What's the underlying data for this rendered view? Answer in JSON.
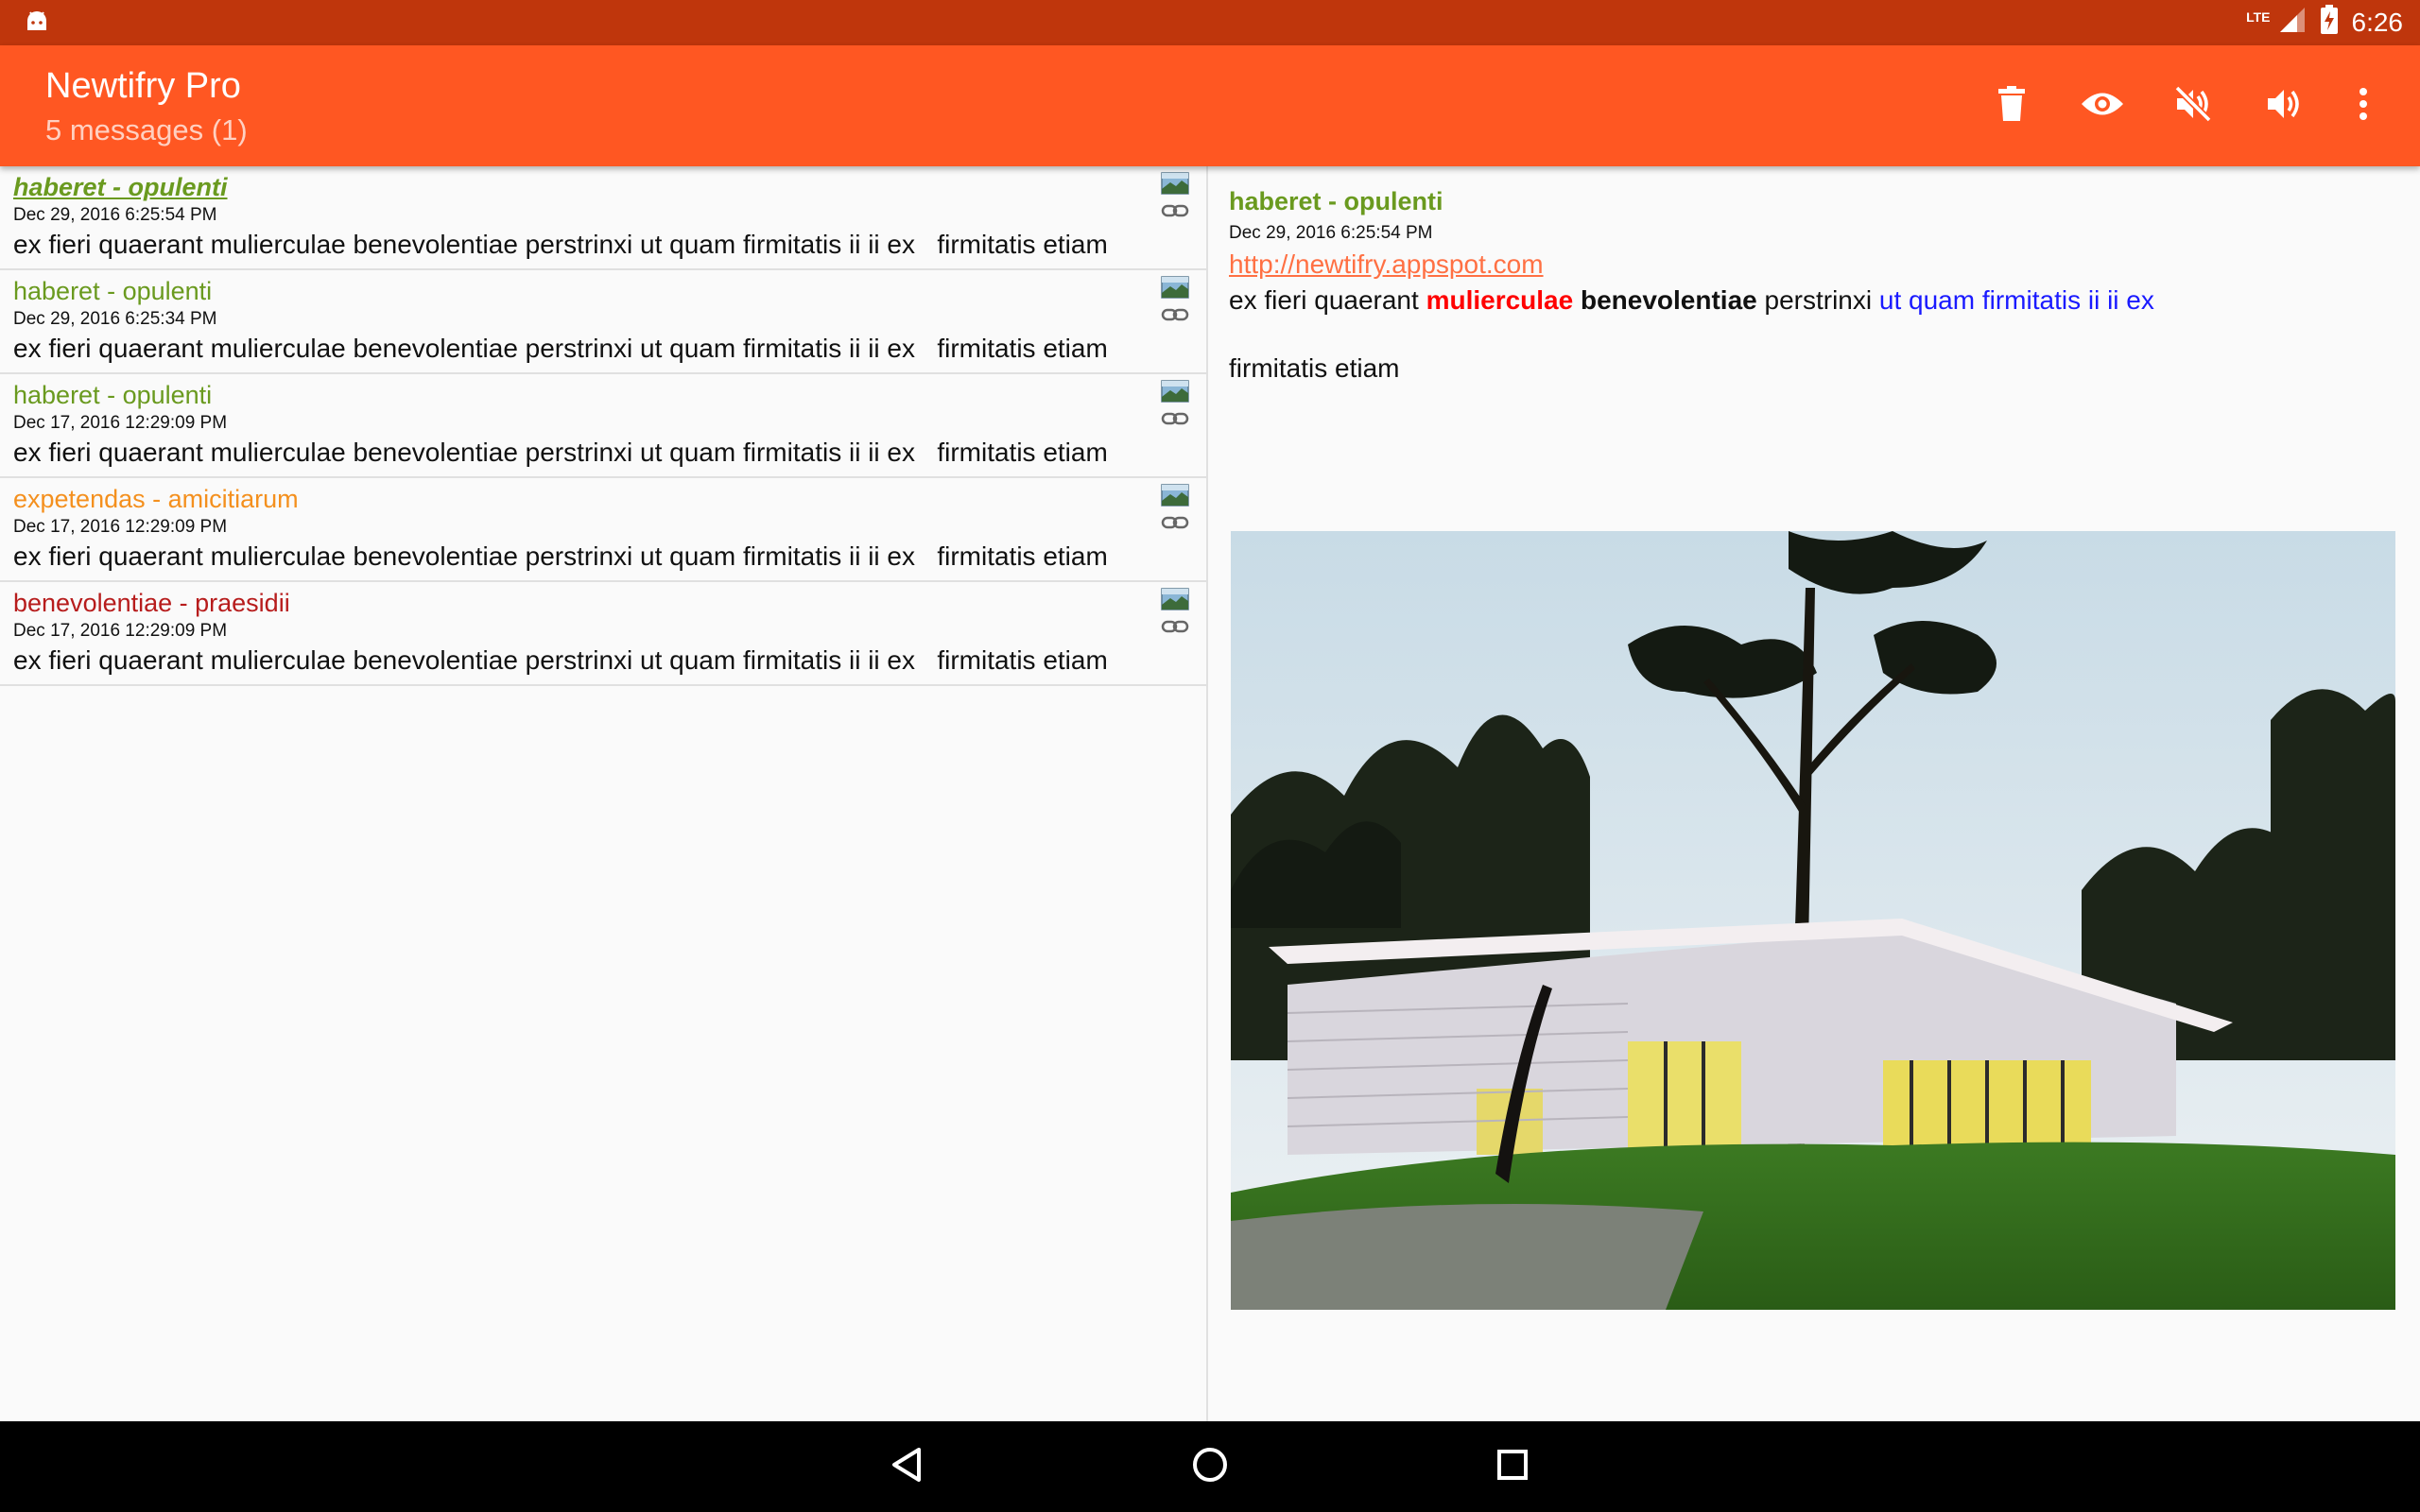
{
  "status_bar": {
    "network": "LTE",
    "time": "6:26"
  },
  "app_bar": {
    "title": "Newtifry Pro",
    "subtitle": "5 messages (1)",
    "actions": [
      "delete-icon",
      "eye-icon",
      "volume-off-icon",
      "volume-up-icon",
      "more-vert-icon"
    ]
  },
  "messages": [
    {
      "title": "haberet - opulenti",
      "date": "Dec 29, 2016 6:25:54 PM",
      "body": "ex fieri quaerant mulierculae benevolentiae perstrinxi ut quam firmitatis ii ii ex   firmitatis etiam",
      "color": "#6a9a1f",
      "selected": true
    },
    {
      "title": "haberet - opulenti",
      "date": "Dec 29, 2016 6:25:34 PM",
      "body": "ex fieri quaerant mulierculae benevolentiae perstrinxi ut quam firmitatis ii ii ex   firmitatis etiam",
      "color": "#6a9a1f",
      "selected": false
    },
    {
      "title": "haberet - opulenti",
      "date": "Dec 17, 2016 12:29:09 PM",
      "body": "ex fieri quaerant mulierculae benevolentiae perstrinxi ut quam firmitatis ii ii ex   firmitatis etiam",
      "color": "#6a9a1f",
      "selected": false
    },
    {
      "title": "expetendas - amicitiarum",
      "date": "Dec 17, 2016 12:29:09 PM",
      "body": "ex fieri quaerant mulierculae benevolentiae perstrinxi ut quam firmitatis ii ii ex   firmitatis etiam",
      "color": "#f4901e",
      "selected": false
    },
    {
      "title": "benevolentiae - praesidii",
      "date": "Dec 17, 2016 12:29:09 PM",
      "body": "ex fieri quaerant mulierculae benevolentiae perstrinxi ut quam firmitatis ii ii ex   firmitatis etiam",
      "color": "#b71c1c",
      "selected": false
    }
  ],
  "detail": {
    "title": "haberet - opulenti",
    "date": "Dec 29, 2016 6:25:54 PM",
    "link": "http://newtifry.appspot.com",
    "body_plain_1": "ex fieri quaerant ",
    "body_red": "mulierculae",
    "body_space_1": " ",
    "body_bold": "benevolentiae",
    "body_plain_2": " perstrinxi ",
    "body_blue": "ut quam firmitatis ii ii ex",
    "body_plain_3": "\n\nfirmitatis etiam",
    "image": "house-photo"
  },
  "colors": {
    "status_bar": "#bf360c",
    "app_bar": "#ff5722",
    "link": "#ff7043"
  }
}
